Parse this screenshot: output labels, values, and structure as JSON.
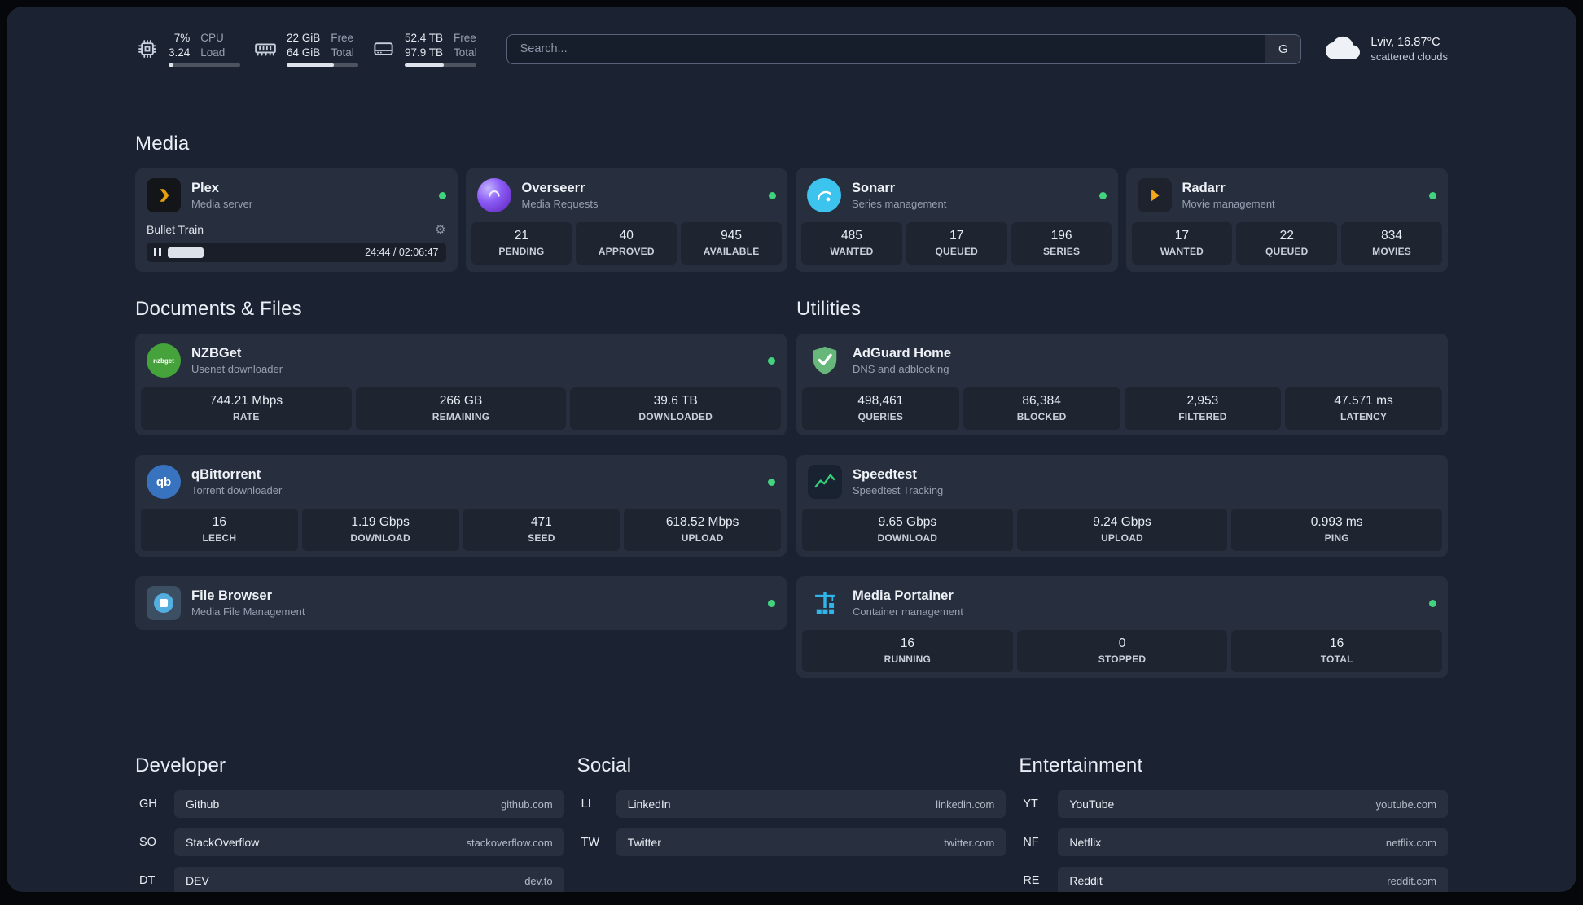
{
  "topbar": {
    "cpu": {
      "icon": "cpu-icon",
      "values": [
        "7%",
        "3.24"
      ],
      "labels": [
        "CPU",
        "Load"
      ],
      "progress": 7
    },
    "memory": {
      "icon": "memory-icon",
      "values": [
        "22 GiB",
        "64 GiB"
      ],
      "labels": [
        "Free",
        "Total"
      ],
      "progress": 66
    },
    "disk": {
      "icon": "disk-icon",
      "values": [
        "52.4 TB",
        "97.9 TB"
      ],
      "labels": [
        "Free",
        "Total"
      ],
      "progress": 54
    },
    "search": {
      "placeholder": "Search...",
      "provider": "G"
    },
    "weather": {
      "icon": "cloud-icon",
      "location": "Lviv, 16.87°C",
      "condition": "scattered clouds"
    }
  },
  "sections": {
    "media": {
      "title": "Media",
      "cards": [
        {
          "name": "Plex",
          "subtitle": "Media server",
          "icon": "plex-icon",
          "online": true,
          "player": {
            "title": "Bullet Train",
            "time": "24:44 / 02:06:47",
            "progress": 19
          }
        },
        {
          "name": "Overseerr",
          "subtitle": "Media Requests",
          "icon": "overseerr-icon",
          "online": true,
          "stats": [
            {
              "value": "21",
              "label": "PENDING"
            },
            {
              "value": "40",
              "label": "APPROVED"
            },
            {
              "value": "945",
              "label": "AVAILABLE"
            }
          ]
        },
        {
          "name": "Sonarr",
          "subtitle": "Series management",
          "icon": "sonarr-icon",
          "online": true,
          "stats": [
            {
              "value": "485",
              "label": "WANTED"
            },
            {
              "value": "17",
              "label": "QUEUED"
            },
            {
              "value": "196",
              "label": "SERIES"
            }
          ]
        },
        {
          "name": "Radarr",
          "subtitle": "Movie management",
          "icon": "radarr-icon",
          "online": true,
          "stats": [
            {
              "value": "17",
              "label": "WANTED"
            },
            {
              "value": "22",
              "label": "QUEUED"
            },
            {
              "value": "834",
              "label": "MOVIES"
            }
          ]
        }
      ]
    },
    "documents": {
      "title": "Documents & Files",
      "cards": [
        {
          "name": "NZBGet",
          "subtitle": "Usenet downloader",
          "icon": "nzbget-icon",
          "online": true,
          "stats": [
            {
              "value": "744.21 Mbps",
              "label": "RATE"
            },
            {
              "value": "266 GB",
              "label": "REMAINING"
            },
            {
              "value": "39.6 TB",
              "label": "DOWNLOADED"
            }
          ]
        },
        {
          "name": "qBittorrent",
          "subtitle": "Torrent downloader",
          "icon": "qbittorrent-icon",
          "online": true,
          "stats": [
            {
              "value": "16",
              "label": "LEECH"
            },
            {
              "value": "1.19 Gbps",
              "label": "DOWNLOAD"
            },
            {
              "value": "471",
              "label": "SEED"
            },
            {
              "value": "618.52 Mbps",
              "label": "UPLOAD"
            }
          ]
        },
        {
          "name": "File Browser",
          "subtitle": "Media File Management",
          "icon": "filebrowser-icon",
          "online": true,
          "stats": []
        }
      ]
    },
    "utilities": {
      "title": "Utilities",
      "cards": [
        {
          "name": "AdGuard Home",
          "subtitle": "DNS and adblocking",
          "icon": "adguard-icon",
          "online": false,
          "stats": [
            {
              "value": "498,461",
              "label": "QUERIES"
            },
            {
              "value": "86,384",
              "label": "BLOCKED"
            },
            {
              "value": "2,953",
              "label": "FILTERED"
            },
            {
              "value": "47.571 ms",
              "label": "LATENCY"
            }
          ]
        },
        {
          "name": "Speedtest",
          "subtitle": "Speedtest Tracking",
          "icon": "speedtest-icon",
          "online": false,
          "stats": [
            {
              "value": "9.65 Gbps",
              "label": "DOWNLOAD"
            },
            {
              "value": "9.24 Gbps",
              "label": "UPLOAD"
            },
            {
              "value": "0.993 ms",
              "label": "PING"
            }
          ]
        },
        {
          "name": "Media Portainer",
          "subtitle": "Container management",
          "icon": "portainer-icon",
          "online": true,
          "stats": [
            {
              "value": "16",
              "label": "RUNNING"
            },
            {
              "value": "0",
              "label": "STOPPED"
            },
            {
              "value": "16",
              "label": "TOTAL"
            }
          ]
        }
      ]
    }
  },
  "bookmarks": {
    "developer": {
      "title": "Developer",
      "items": [
        {
          "abbr": "GH",
          "name": "Github",
          "domain": "github.com"
        },
        {
          "abbr": "SO",
          "name": "StackOverflow",
          "domain": "stackoverflow.com"
        },
        {
          "abbr": "DT",
          "name": "DEV",
          "domain": "dev.to"
        }
      ]
    },
    "social": {
      "title": "Social",
      "items": [
        {
          "abbr": "LI",
          "name": "LinkedIn",
          "domain": "linkedin.com"
        },
        {
          "abbr": "TW",
          "name": "Twitter",
          "domain": "twitter.com"
        }
      ]
    },
    "entertainment": {
      "title": "Entertainment",
      "items": [
        {
          "abbr": "YT",
          "name": "YouTube",
          "domain": "youtube.com"
        },
        {
          "abbr": "NF",
          "name": "Netflix",
          "domain": "netflix.com"
        },
        {
          "abbr": "RE",
          "name": "Reddit",
          "domain": "reddit.com"
        }
      ]
    }
  },
  "colors": {
    "status_online": "#41d37e",
    "background": "#1b2333",
    "plex_accent": "#e5a00d"
  }
}
